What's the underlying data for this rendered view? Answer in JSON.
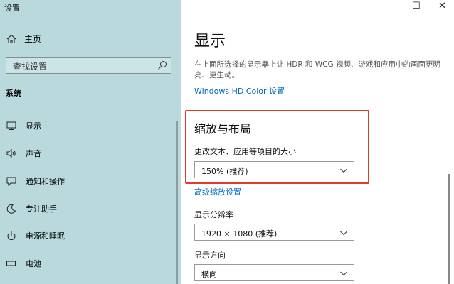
{
  "app": {
    "title": "设置"
  },
  "window": {
    "minimize": "–",
    "maximize": "☐",
    "close": "✕"
  },
  "sidebar": {
    "home_label": "主页",
    "search_placeholder": "查找设置",
    "section": "系统",
    "items": [
      {
        "label": "显示",
        "icon": "monitor-icon"
      },
      {
        "label": "声音",
        "icon": "speaker-icon"
      },
      {
        "label": "通知和操作",
        "icon": "notification-icon"
      },
      {
        "label": "专注助手",
        "icon": "moon-icon"
      },
      {
        "label": "电源和睡眠",
        "icon": "power-icon"
      },
      {
        "label": "电池",
        "icon": "battery-icon"
      }
    ]
  },
  "main": {
    "title": "显示",
    "description": "在上面所选择的显示器上让 HDR 和 WCG 视频、游戏和应用中的画面更明亮、更生动。",
    "hdr_link": "Windows HD Color 设置",
    "scale_layout": {
      "heading": "缩放与布局",
      "text_size_label": "更改文本、应用等项目的大小",
      "text_size_value": "150% (推荐)",
      "advanced_link": "高级缩放设置",
      "resolution_label": "显示分辨率",
      "resolution_value": "1920 × 1080 (推荐)",
      "orientation_label": "显示方向",
      "orientation_value": "横向"
    }
  },
  "colors": {
    "sidebar_bg": "#b9d9dc",
    "link": "#0067c0",
    "highlight": "#e23b2e"
  }
}
